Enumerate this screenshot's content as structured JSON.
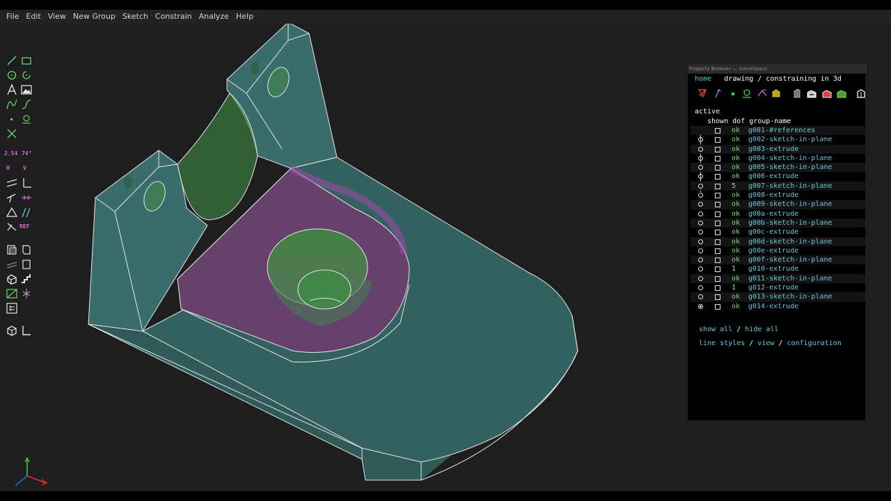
{
  "menu": [
    "File",
    "Edit",
    "View",
    "New Group",
    "Sketch",
    "Constrain",
    "Analyze",
    "Help"
  ],
  "toolbar": {
    "dim_label": "2.54",
    "angle_label": "74°",
    "h_label": "H",
    "v_label": "V",
    "ref_label": "REF",
    "icons": [
      "line-icon",
      "rectangle-icon",
      "circle-icon",
      "arc-icon",
      "text-icon",
      "image-icon",
      "bezier-icon",
      "spline-icon",
      "point-icon",
      "workplane-icon",
      "construction-icon",
      "distance-dim-icon",
      "angle-dim-icon",
      "horizontal-icon",
      "vertical-icon",
      "parallel-icon",
      "perpendicular-icon",
      "on-point-icon",
      "symmetric-icon",
      "equal-icon",
      "tangent-icon",
      "reference-icon",
      "extrude-icon",
      "lathe-icon",
      "sweep-icon",
      "helix-icon",
      "step-rotate-icon",
      "step-translate-icon",
      "workplane-group-icon",
      "assemble-icon",
      "nearest-iso-icon",
      "nearest-ortho-icon"
    ]
  },
  "property_browser": {
    "window_title": "Property Browser — SolveSpace",
    "nav": {
      "home": "home",
      "breadcrumb": "drawing / constraining in 3d"
    },
    "icons": [
      "show-workplanes-icon",
      "show-normals-icon",
      "show-points-icon",
      "show-construction-icon",
      "show-constraints-icon",
      "show-faces-icon",
      "show-shaded-icon",
      "show-edges-icon",
      "show-outlines-icon",
      "show-mesh-icon",
      "show-hidden-icon"
    ],
    "active_label": "active",
    "header": "shown dof group-name",
    "groups": [
      {
        "radio": false,
        "dof": "ok",
        "name": "g001-#references",
        "selected": false
      },
      {
        "radio": true,
        "dof": "ok",
        "name": "g002-sketch-in-plane",
        "selected": false
      },
      {
        "radio": true,
        "dof": "ok",
        "name": "g003-extrude",
        "selected": false
      },
      {
        "radio": true,
        "dof": "ok",
        "name": "g004-sketch-in-plane",
        "selected": false
      },
      {
        "radio": true,
        "dof": "ok",
        "name": "g005-sketch-in-plane",
        "selected": false
      },
      {
        "radio": true,
        "dof": "ok",
        "name": "g006-extrude",
        "selected": false
      },
      {
        "radio": true,
        "dof": "5",
        "name": "g007-sketch-in-plane",
        "selected": false
      },
      {
        "radio": true,
        "dof": "ok",
        "name": "g008-extrude",
        "selected": false
      },
      {
        "radio": true,
        "dof": "ok",
        "name": "g009-sketch-in-plane",
        "selected": false
      },
      {
        "radio": true,
        "dof": "ok",
        "name": "g00a-extrude",
        "selected": false
      },
      {
        "radio": true,
        "dof": "ok",
        "name": "g00b-sketch-in-plane",
        "selected": false
      },
      {
        "radio": true,
        "dof": "ok",
        "name": "g00c-extrude",
        "selected": false
      },
      {
        "radio": true,
        "dof": "ok",
        "name": "g00d-sketch-in-plane",
        "selected": false
      },
      {
        "radio": true,
        "dof": "ok",
        "name": "g00e-extrude",
        "selected": false
      },
      {
        "radio": true,
        "dof": "ok",
        "name": "g00f-sketch-in-plane",
        "selected": false
      },
      {
        "radio": true,
        "dof": "1",
        "name": "g010-extrude",
        "selected": false
      },
      {
        "radio": true,
        "dof": "ok",
        "name": "g011-sketch-in-plane",
        "selected": false
      },
      {
        "radio": true,
        "dof": "1",
        "name": "g012-extrude",
        "selected": false
      },
      {
        "radio": true,
        "dof": "ok",
        "name": "g013-sketch-in-plane",
        "selected": false
      },
      {
        "radio": true,
        "dof": "ok",
        "name": "g014-extrude",
        "selected": true
      }
    ],
    "show_all": "show all",
    "hide_all": "hide all",
    "line_styles": "line styles",
    "view": "view",
    "configuration": "configuration",
    "sep": " / "
  },
  "colors": {
    "model_fill": "#3a6e6b",
    "model_edge": "#e8e8e8",
    "selected_face": "#6a3f6e",
    "hole": "#3f8a45",
    "link": "#6ac8d8",
    "ok": "#7ed96b"
  }
}
